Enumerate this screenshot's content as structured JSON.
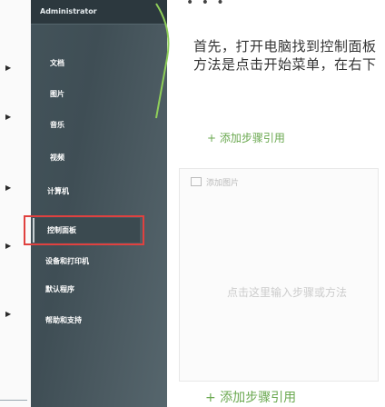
{
  "menu": {
    "header": "Administrator",
    "items": [
      {
        "label": "文档"
      },
      {
        "label": "图片"
      },
      {
        "label": "音乐"
      },
      {
        "label": "视频"
      },
      {
        "label": "计算机"
      },
      {
        "label": "控制面板"
      },
      {
        "label": "设备和打印机"
      },
      {
        "label": "默认程序"
      },
      {
        "label": "帮助和支持"
      }
    ]
  },
  "article": {
    "title_line1": "首先，打开电脑找到控制面板",
    "title_line2": "方法是点击开始菜单，在右下",
    "add_step_top": "+ 添加步骤引用",
    "image_hint": "添加图片",
    "placeholder": "点击这里输入步骤或方法",
    "add_step_bottom": "+ 添加步骤引用",
    "dots": "• • •"
  },
  "colors": {
    "accent_green": "#6aa84f",
    "highlight_red": "#e0413f",
    "menu_bg": "#43535a"
  }
}
